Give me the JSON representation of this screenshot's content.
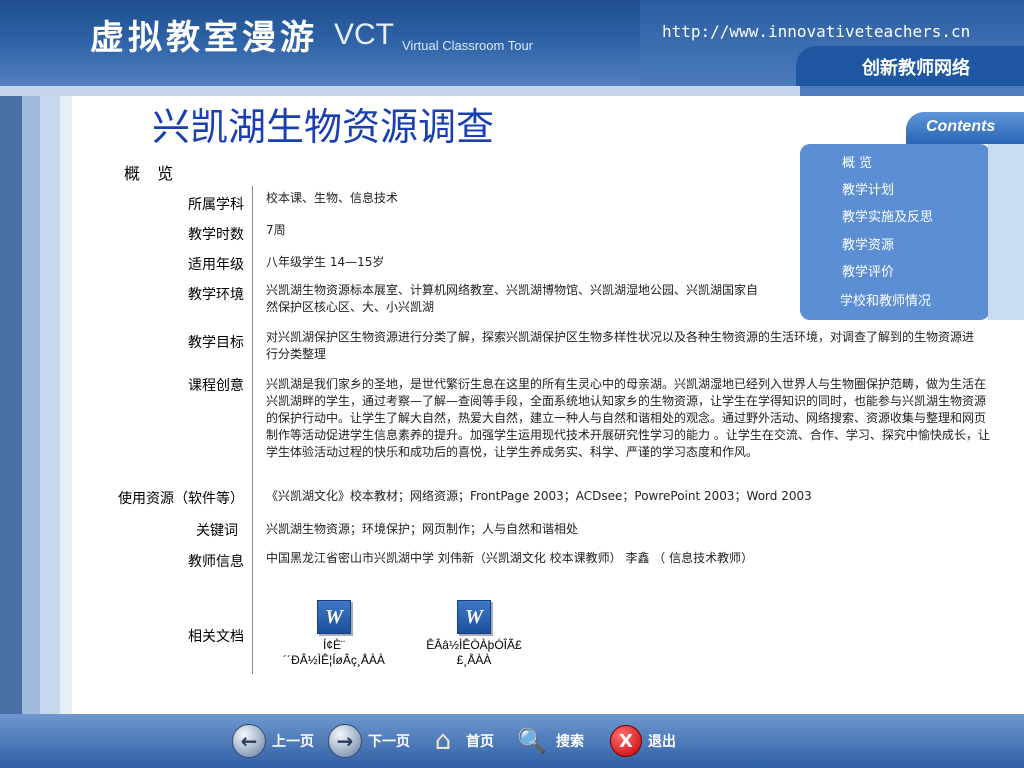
{
  "header": {
    "title_cn": "虚拟教室漫游",
    "title_vct": "VCT",
    "title_en": "Virtual Classroom Tour",
    "url": "http://www.innovativeteachers.cn",
    "brand": "创新教师网络"
  },
  "page_title": "兴凯湖生物资源调查",
  "section_label": "概 览",
  "contents": {
    "heading": "Contents",
    "items": [
      "概 览",
      "教学计划",
      "教学实施及反思",
      "教学资源",
      "教学评价",
      "学校和教师情况"
    ]
  },
  "form": {
    "subject": {
      "label": "所属学科",
      "value": "校本课、生物、信息技术"
    },
    "hours": {
      "label": "教学时数",
      "value": "7周"
    },
    "grade": {
      "label": "适用年级",
      "value": "八年级学生 14—15岁"
    },
    "environment": {
      "label": "教学环境",
      "value": "兴凯湖生物资源标本展室、计算机网络教室、兴凯湖博物馆、兴凯湖湿地公园、兴凯湖国家自然保护区核心区、大、小兴凯湖"
    },
    "goal": {
      "label": "教学目标",
      "value": "对兴凯湖保护区生物资源进行分类了解，探索兴凯湖保护区生物多样性状况以及各种生物资源的生活环境，对调查了解到的生物资源进行分类整理"
    },
    "idea": {
      "label": "课程创意",
      "value": "兴凯湖是我们家乡的圣地，是世代繁衍生息在这里的所有生灵心中的母亲湖。兴凯湖湿地已经列入世界人与生物圈保护范畴，做为生活在兴凯湖畔的学生，通过考察—了解—查阅等手段，全面系统地认知家乡的生物资源，让学生在学得知识的同时，也能参与兴凯湖生物资源的保护行动中。让学生了解大自然，热爱大自然，建立一种人与自然和谐相处的观念。通过野外活动、网络搜索、资源收集与整理和网页制作等活动促进学生信息素养的提升。加强学生运用现代技术开展研究性学习的能力 。让学生在交流、合作、学习、探究中愉快成长，让学生体验活动过程的快乐和成功后的喜悦，让学生养成务实、科学、严谨的学习态度和作风。"
    },
    "resources": {
      "label": "使用资源（软件等）",
      "value": "《兴凯湖文化》校本教材；网络资源；FrontPage 2003；ACDsee；PowrePoint 2003；Word 2003"
    },
    "keywords": {
      "label": "关键词",
      "value": "兴凯湖生物资源；环境保护；网页制作；人与自然和谐相处"
    },
    "teacher": {
      "label": "教师信息",
      "value": "中国黑龙江省密山市兴凯湖中学 刘伟新（兴凯湖文化 校本课教师） 李鑫 （ 信息技术教师）"
    },
    "docs": {
      "label": "相关文档",
      "items": [
        {
          "name": "Í¢È¨´´ÐÂ½ÌÊ¦ÍøÂç¸ÅÀÀ",
          "icon": "word-doc-icon"
        },
        {
          "name": "ÊÂâ½ÌÊÒÀþÓÎÃ££¸ÅÀÀ",
          "icon": "word-doc-icon"
        }
      ]
    }
  },
  "footer": {
    "prev": "上一页",
    "next": "下一页",
    "home": "首页",
    "search": "搜索",
    "exit": "退出"
  }
}
